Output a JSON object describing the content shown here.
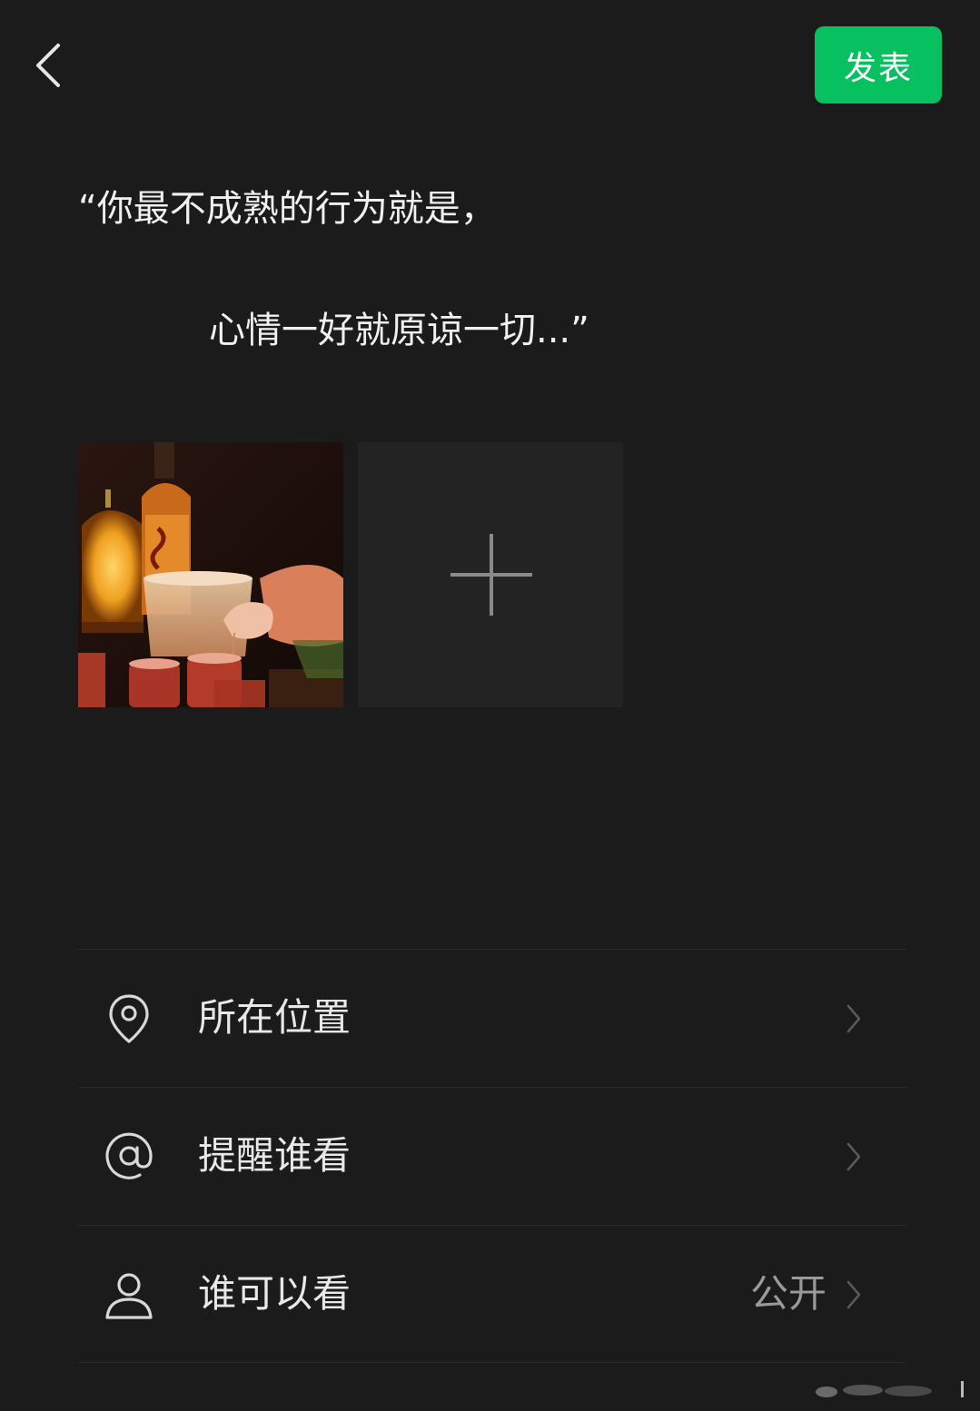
{
  "topbar": {
    "back_icon": "chevron-left-icon",
    "publish_label": "发表",
    "publish_color": "#07c160"
  },
  "post": {
    "line1": "“你最不成熟的行为就是，",
    "line2": "心情一好就原谅一切...”"
  },
  "media": {
    "photo_subject": "cocktail-pour-photo",
    "add_icon": "plus-icon"
  },
  "options": [
    {
      "icon": "location-pin-icon",
      "label": "所在位置",
      "value": ""
    },
    {
      "icon": "at-sign-icon",
      "label": "提醒谁看",
      "value": ""
    },
    {
      "icon": "person-icon",
      "label": "谁可以看",
      "value": "公开"
    }
  ]
}
